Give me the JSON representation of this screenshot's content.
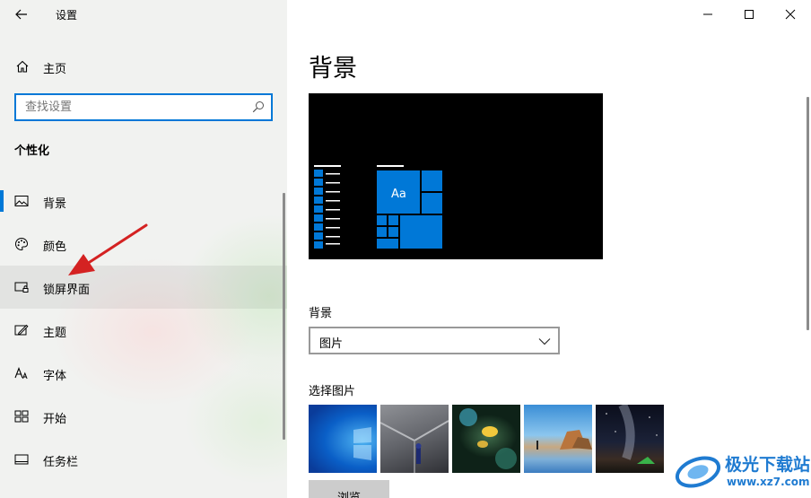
{
  "window": {
    "title": "设置",
    "controls": [
      "minimize",
      "maximize",
      "close"
    ]
  },
  "sidebar": {
    "home_label": "主页",
    "search_placeholder": "查找设置",
    "section_title": "个性化",
    "items": [
      {
        "label": "背景",
        "icon": "picture-icon",
        "selected": true
      },
      {
        "label": "颜色",
        "icon": "palette-icon",
        "selected": false
      },
      {
        "label": "锁屏界面",
        "icon": "lock-screen-icon",
        "selected": false,
        "hovered": true
      },
      {
        "label": "主题",
        "icon": "theme-icon",
        "selected": false
      },
      {
        "label": "字体",
        "icon": "font-icon",
        "selected": false
      },
      {
        "label": "开始",
        "icon": "start-icon",
        "selected": false
      },
      {
        "label": "任务栏",
        "icon": "taskbar-icon",
        "selected": false
      }
    ]
  },
  "main": {
    "title": "背景",
    "preview": {
      "sample_text": "Aa"
    },
    "background_label": "背景",
    "background_value": "图片",
    "choose_picture_label": "选择图片",
    "browse_label": "浏览"
  },
  "watermark": {
    "name": "极光下载站",
    "url": "www.xz7.com"
  },
  "colors": {
    "accent": "#0078d7",
    "annotation_arrow": "#d42222"
  }
}
